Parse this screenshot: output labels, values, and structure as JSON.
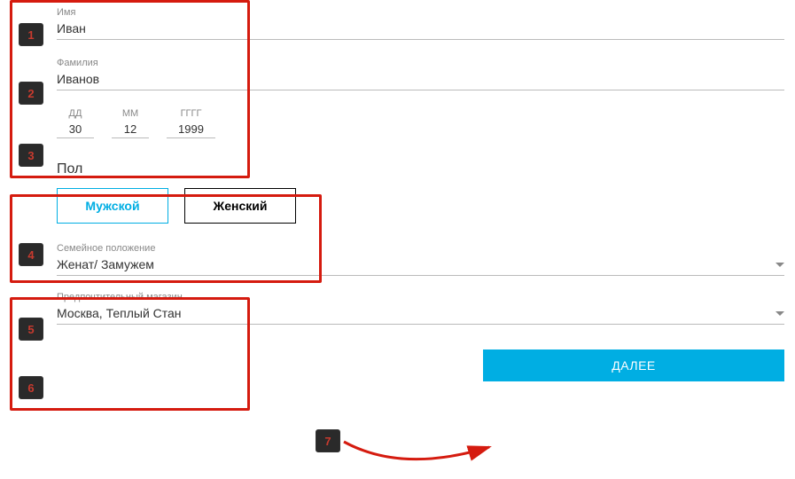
{
  "fields": {
    "first_name": {
      "label": "Имя",
      "value": "Иван"
    },
    "last_name": {
      "label": "Фамилия",
      "value": "Иванов"
    },
    "dob": {
      "day_label": "ДД",
      "day": "30",
      "month_label": "ММ",
      "month": "12",
      "year_label": "ГГГГ",
      "year": "1999"
    },
    "gender": {
      "title": "Пол",
      "male": "Мужской",
      "female": "Женский"
    },
    "marital": {
      "label": "Семейное положение",
      "value": "Женат/ Замужем"
    },
    "store": {
      "label": "Предпочтительный магазин",
      "value": "Москва, Теплый Стан"
    }
  },
  "submit_label": "ДАЛЕЕ",
  "annotations": {
    "b1": "1",
    "b2": "2",
    "b3": "3",
    "b4": "4",
    "b5": "5",
    "b6": "6",
    "b7": "7"
  }
}
